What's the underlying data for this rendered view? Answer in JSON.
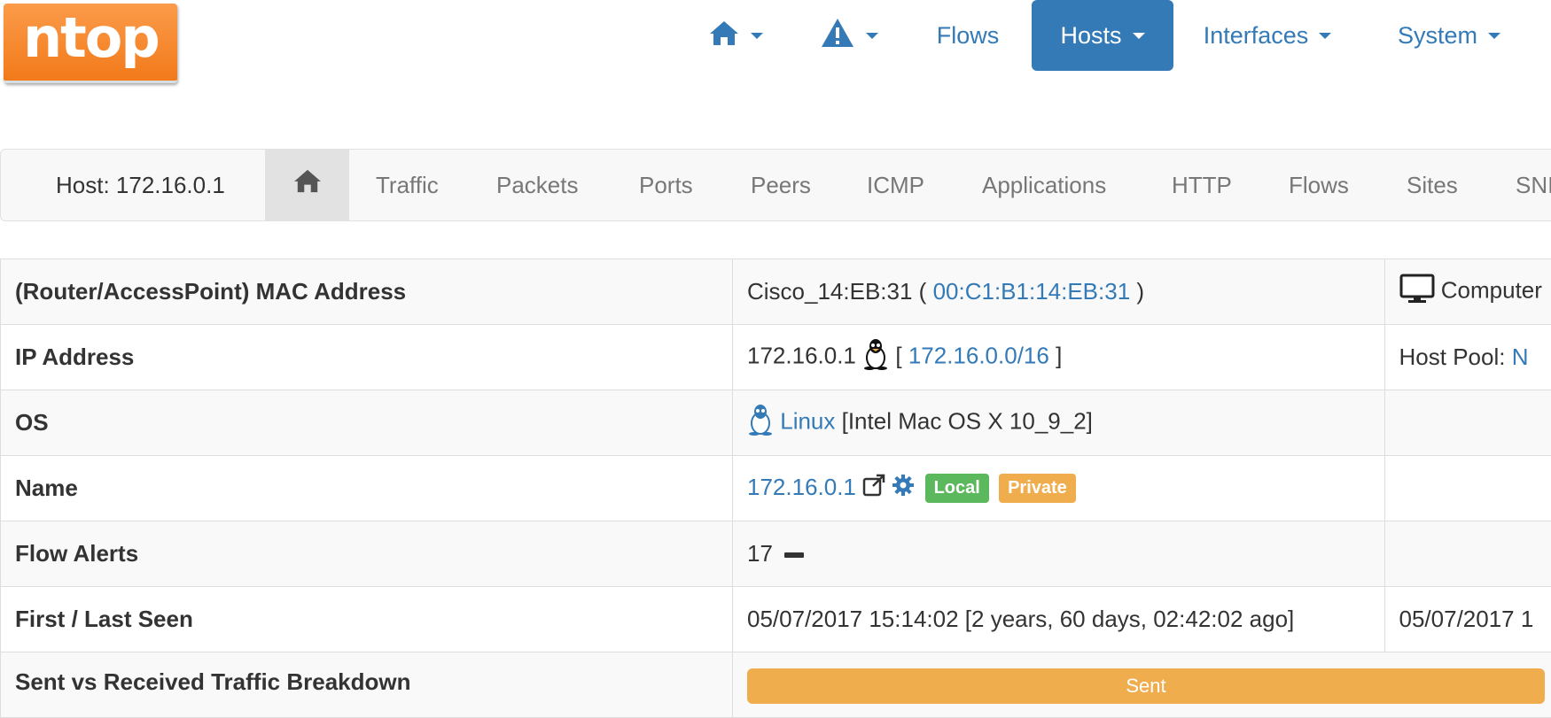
{
  "logo": {
    "text": "ntop"
  },
  "nav": {
    "items": [
      {
        "id": "home",
        "icon": "home-icon",
        "has_caret": true
      },
      {
        "id": "alerts",
        "icon": "warning-icon",
        "has_caret": true
      },
      {
        "id": "flows",
        "label": "Flows",
        "has_caret": false
      },
      {
        "id": "hosts",
        "label": "Hosts",
        "has_caret": true,
        "active": true
      },
      {
        "id": "interfaces",
        "label": "Interfaces",
        "has_caret": true
      },
      {
        "id": "system",
        "label": "System",
        "has_caret": true
      }
    ]
  },
  "subnav": {
    "title": "Host: 172.16.0.1",
    "tabs": [
      "Traffic",
      "Packets",
      "Ports",
      "Peers",
      "ICMP",
      "Applications",
      "HTTP",
      "Flows",
      "Sites",
      "SNI"
    ]
  },
  "table": {
    "mac": {
      "label": "(Router/AccessPoint) MAC Address",
      "vendor": "Cisco_14:EB:31 ( ",
      "mac_link": "00:C1:B1:14:EB:31",
      "suffix": " )",
      "extra": "Computer"
    },
    "ip": {
      "label": "IP Address",
      "ip": "172.16.0.1",
      "bracket_open": " [ ",
      "network_link": "172.16.0.0/16",
      "bracket_close": " ]",
      "extra_label": "Host Pool: ",
      "extra_link": "N"
    },
    "os": {
      "label": "OS",
      "os_link": "Linux",
      "os_detail": " [Intel Mac OS X 10_9_2]"
    },
    "name": {
      "label": "Name",
      "name_link": "172.16.0.1",
      "badge_local": "Local",
      "badge_private": "Private"
    },
    "alerts": {
      "label": "Flow Alerts",
      "value": "17"
    },
    "seen": {
      "label": "First / Last Seen",
      "first": "05/07/2017 15:14:02 [2 years, 60 days, 02:42:02 ago]",
      "last": "05/07/2017 1"
    },
    "breakdown": {
      "label": "Sent vs Received Traffic Breakdown",
      "bar_label": "Sent"
    }
  },
  "colors": {
    "accent": "#337ab7",
    "logo": "#f7882f",
    "local": "#5cb85c",
    "private": "#f0ad4e"
  }
}
